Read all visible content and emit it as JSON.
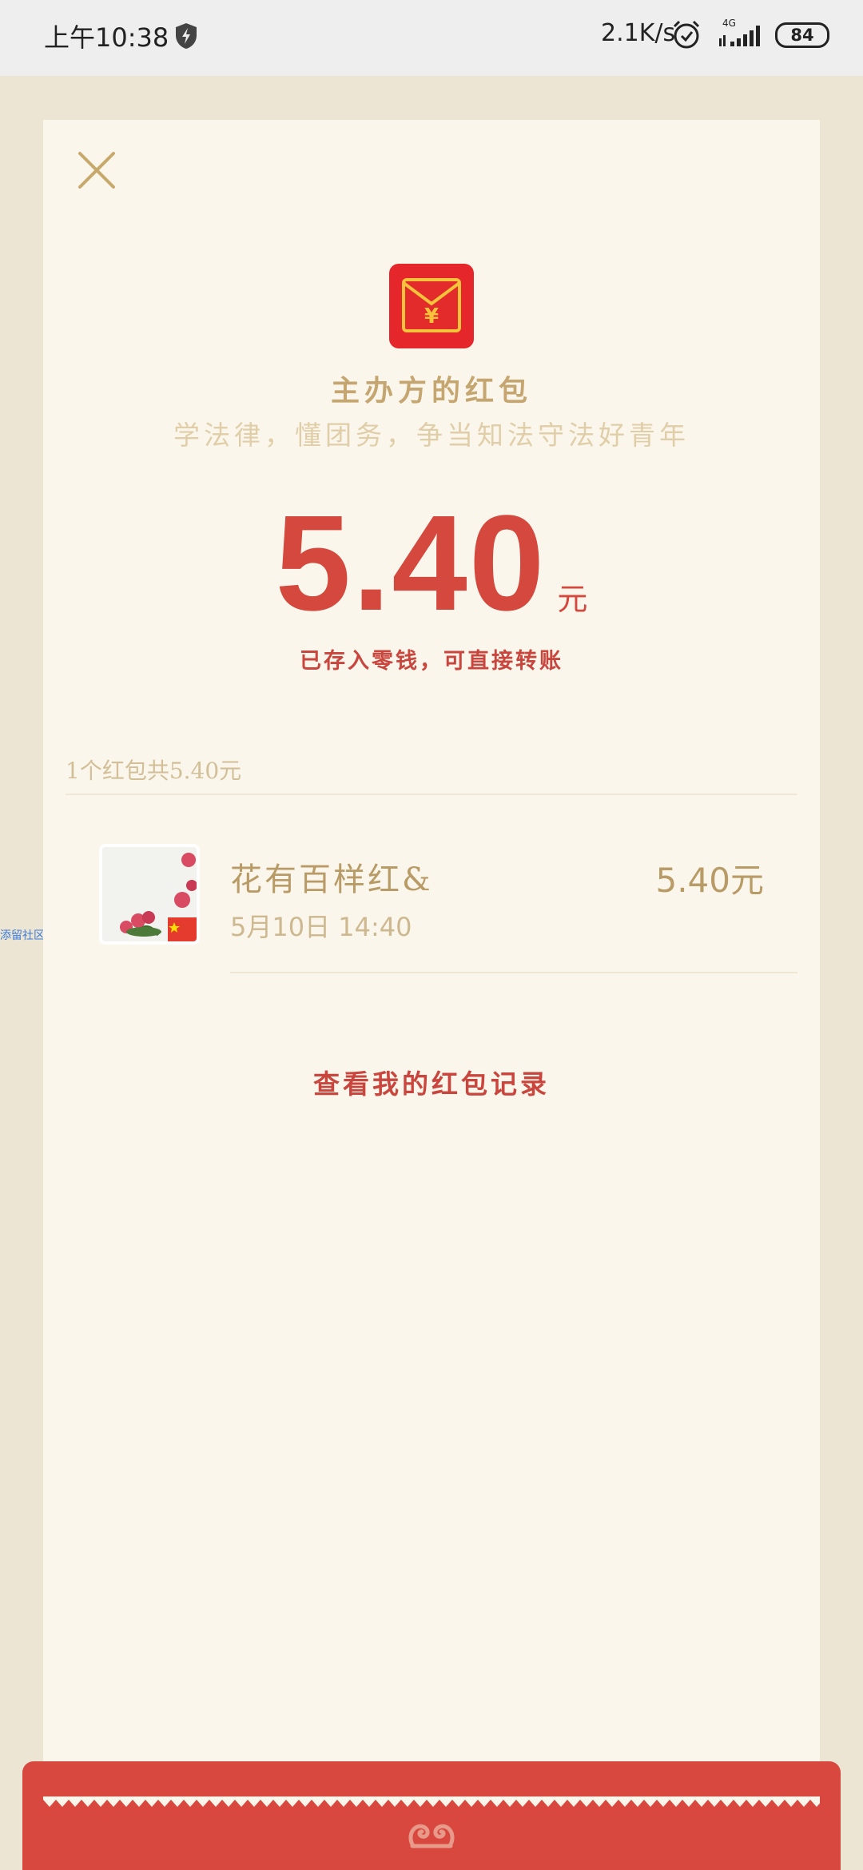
{
  "status_bar": {
    "time": "上午10:38",
    "net_speed": "2.1K/s",
    "network_type": "4G",
    "battery": "84"
  },
  "side_tag": "添留社区",
  "red_packet": {
    "sender": "主办方的红包",
    "greeting": "学法律，懂团务，争当知法守法好青年",
    "amount": "5.40",
    "unit": "元",
    "saved_note": "已存入零钱，可直接转账",
    "summary": "1个红包共5.40元",
    "records": [
      {
        "name": "花有百样红&",
        "time": "5月10日  14:40",
        "amount": "5.40元"
      }
    ],
    "history_link": "查看我的红包记录"
  },
  "colors": {
    "accent_red": "#D5483E",
    "gold": "#C5A670",
    "card_bg": "#FBF6EB",
    "page_bg": "#EDE5D4"
  },
  "icons": [
    "shield-icon",
    "alarm-icon",
    "signal-icon",
    "close-icon",
    "red-packet-icon",
    "swirl-icon"
  ]
}
